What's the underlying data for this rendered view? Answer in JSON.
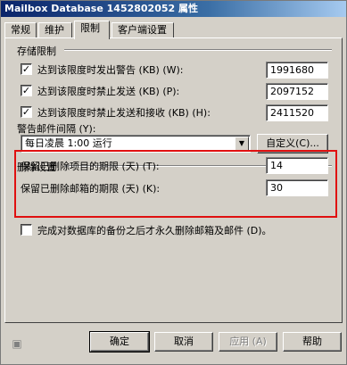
{
  "window": {
    "title": "Mailbox Database 1452802052 属性"
  },
  "tabs": [
    {
      "label": "常规"
    },
    {
      "label": "维护"
    },
    {
      "label": "限制"
    },
    {
      "label": "客户端设置"
    }
  ],
  "storage": {
    "section_label": "存储限制",
    "rows": [
      {
        "label": "达到该限度时发出警告 (KB) (W):",
        "checked": true,
        "value": "1991680"
      },
      {
        "label": "达到该限度时禁止发送 (KB) (P):",
        "checked": true,
        "value": "2097152"
      },
      {
        "label": "达到该限度时禁止发送和接收 (KB) (H):",
        "checked": true,
        "value": "2411520"
      }
    ]
  },
  "warning": {
    "label": "警告邮件间隔 (Y):",
    "selected": "每日凌晨 1:00 运行",
    "customize_label": "自定义(C)..."
  },
  "deletion": {
    "section_label": "删除设置",
    "items_label": "保留已删除项目的期限 (天) (T):",
    "items_value": "14",
    "mailbox_label": "保留已删除邮箱的期限 (天) (K):",
    "mailbox_value": "30",
    "backup_label": "完成对数据库的备份之后才永久删除邮箱及邮件 (D)。",
    "backup_checked": false
  },
  "buttons": {
    "ok": "确定",
    "cancel": "取消",
    "apply": "应用 (A)",
    "help": "帮助"
  },
  "colors": {
    "highlight": "#e01010",
    "titlebar": "#0a246a"
  },
  "icons": {
    "footer": "help-page-icon",
    "checkmark": "✓",
    "dropdown": "▼"
  }
}
